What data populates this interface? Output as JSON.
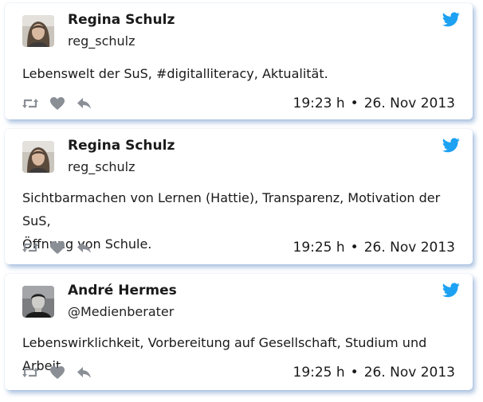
{
  "tweets": [
    {
      "name": "Regina Schulz",
      "handle": "reg_schulz",
      "text_lines": [
        "Lebenswelt der SuS, #digitalliteracy, Aktualität."
      ],
      "time": "19:23 h",
      "date": "26. Nov 2013",
      "avatar": "female-avatar"
    },
    {
      "name": "Regina Schulz",
      "handle": "reg_schulz",
      "text_lines": [
        "Sichtbarmachen von Lernen (Hattie), Transparenz, Motivation der SuS,",
        "Öffnung von Schule."
      ],
      "time": "19:25 h",
      "date": "26. Nov 2013",
      "avatar": "female-avatar"
    },
    {
      "name": "André Hermes",
      "handle": "@Medienberater",
      "text_lines": [
        "Lebenswirklichkeit, Vorbereitung auf Gesellschaft, Studium und Arbeit."
      ],
      "time": "19:25 h",
      "date": "26. Nov 2013",
      "avatar": "male-avatar"
    }
  ],
  "separator": "•",
  "icons": {
    "brand": "twitter-bird-icon",
    "retweet": "retweet-icon",
    "favorite": "heart-icon",
    "reply": "reply-icon"
  },
  "colors": {
    "twitter_blue": "#1da1f2",
    "action_gray": "#8a8f96",
    "card_shadow": "#6991c8"
  }
}
